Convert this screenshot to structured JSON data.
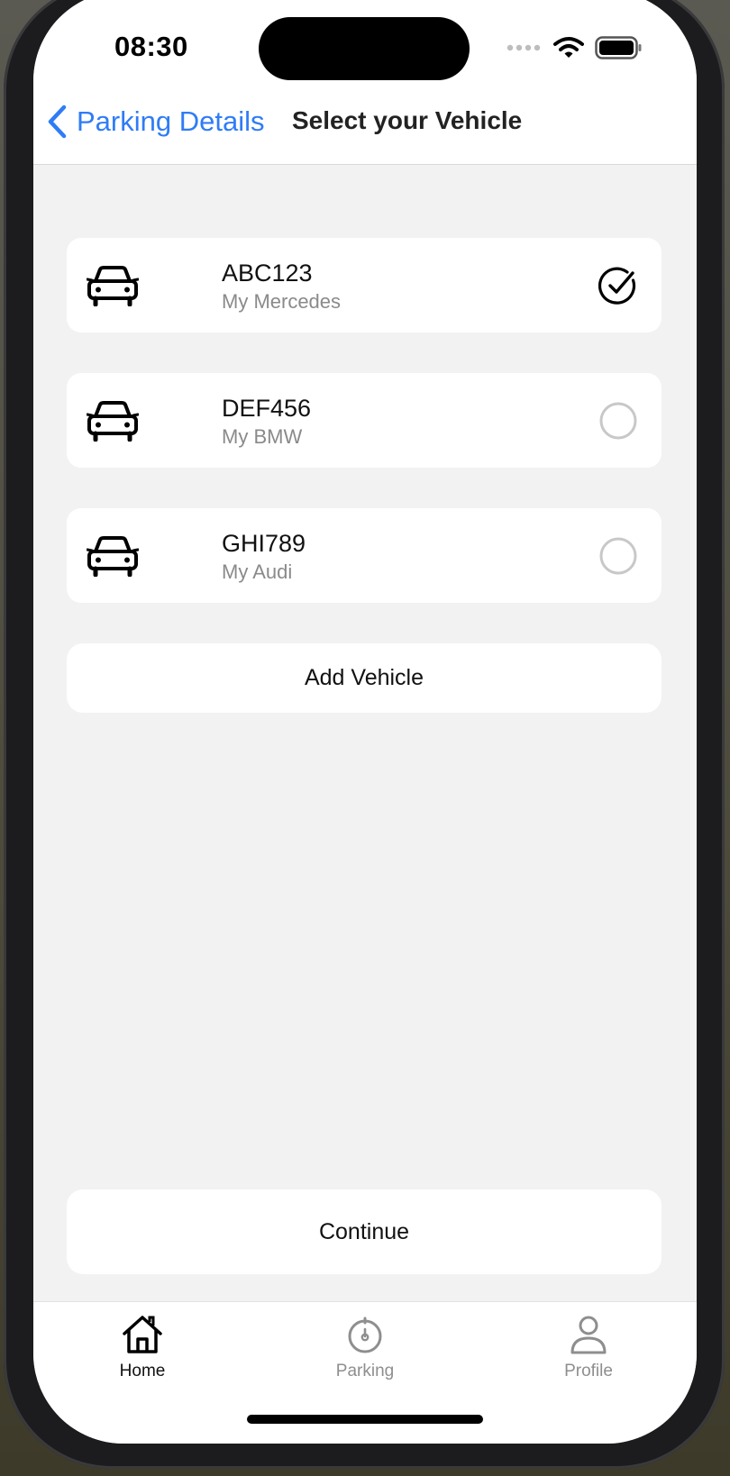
{
  "status_bar": {
    "time": "08:30"
  },
  "nav": {
    "back_label": "Parking Details",
    "title": "Select your Vehicle"
  },
  "vehicles": [
    {
      "plate": "ABC123",
      "nickname": "My Mercedes",
      "selected": true
    },
    {
      "plate": "DEF456",
      "nickname": "My BMW",
      "selected": false
    },
    {
      "plate": "GHI789",
      "nickname": "My Audi",
      "selected": false
    }
  ],
  "add_vehicle_label": "Add Vehicle",
  "continue_label": "Continue",
  "tabs": [
    {
      "label": "Home",
      "icon": "home-icon",
      "active": true
    },
    {
      "label": "Parking",
      "icon": "parking-timer-icon",
      "active": false
    },
    {
      "label": "Profile",
      "icon": "profile-icon",
      "active": false
    }
  ],
  "colors": {
    "accent": "#2f7cf6",
    "background": "#f2f2f2",
    "card": "#ffffff",
    "text_primary": "#111111",
    "text_secondary": "#8a8a8a",
    "tab_inactive": "#8e8e8e"
  }
}
